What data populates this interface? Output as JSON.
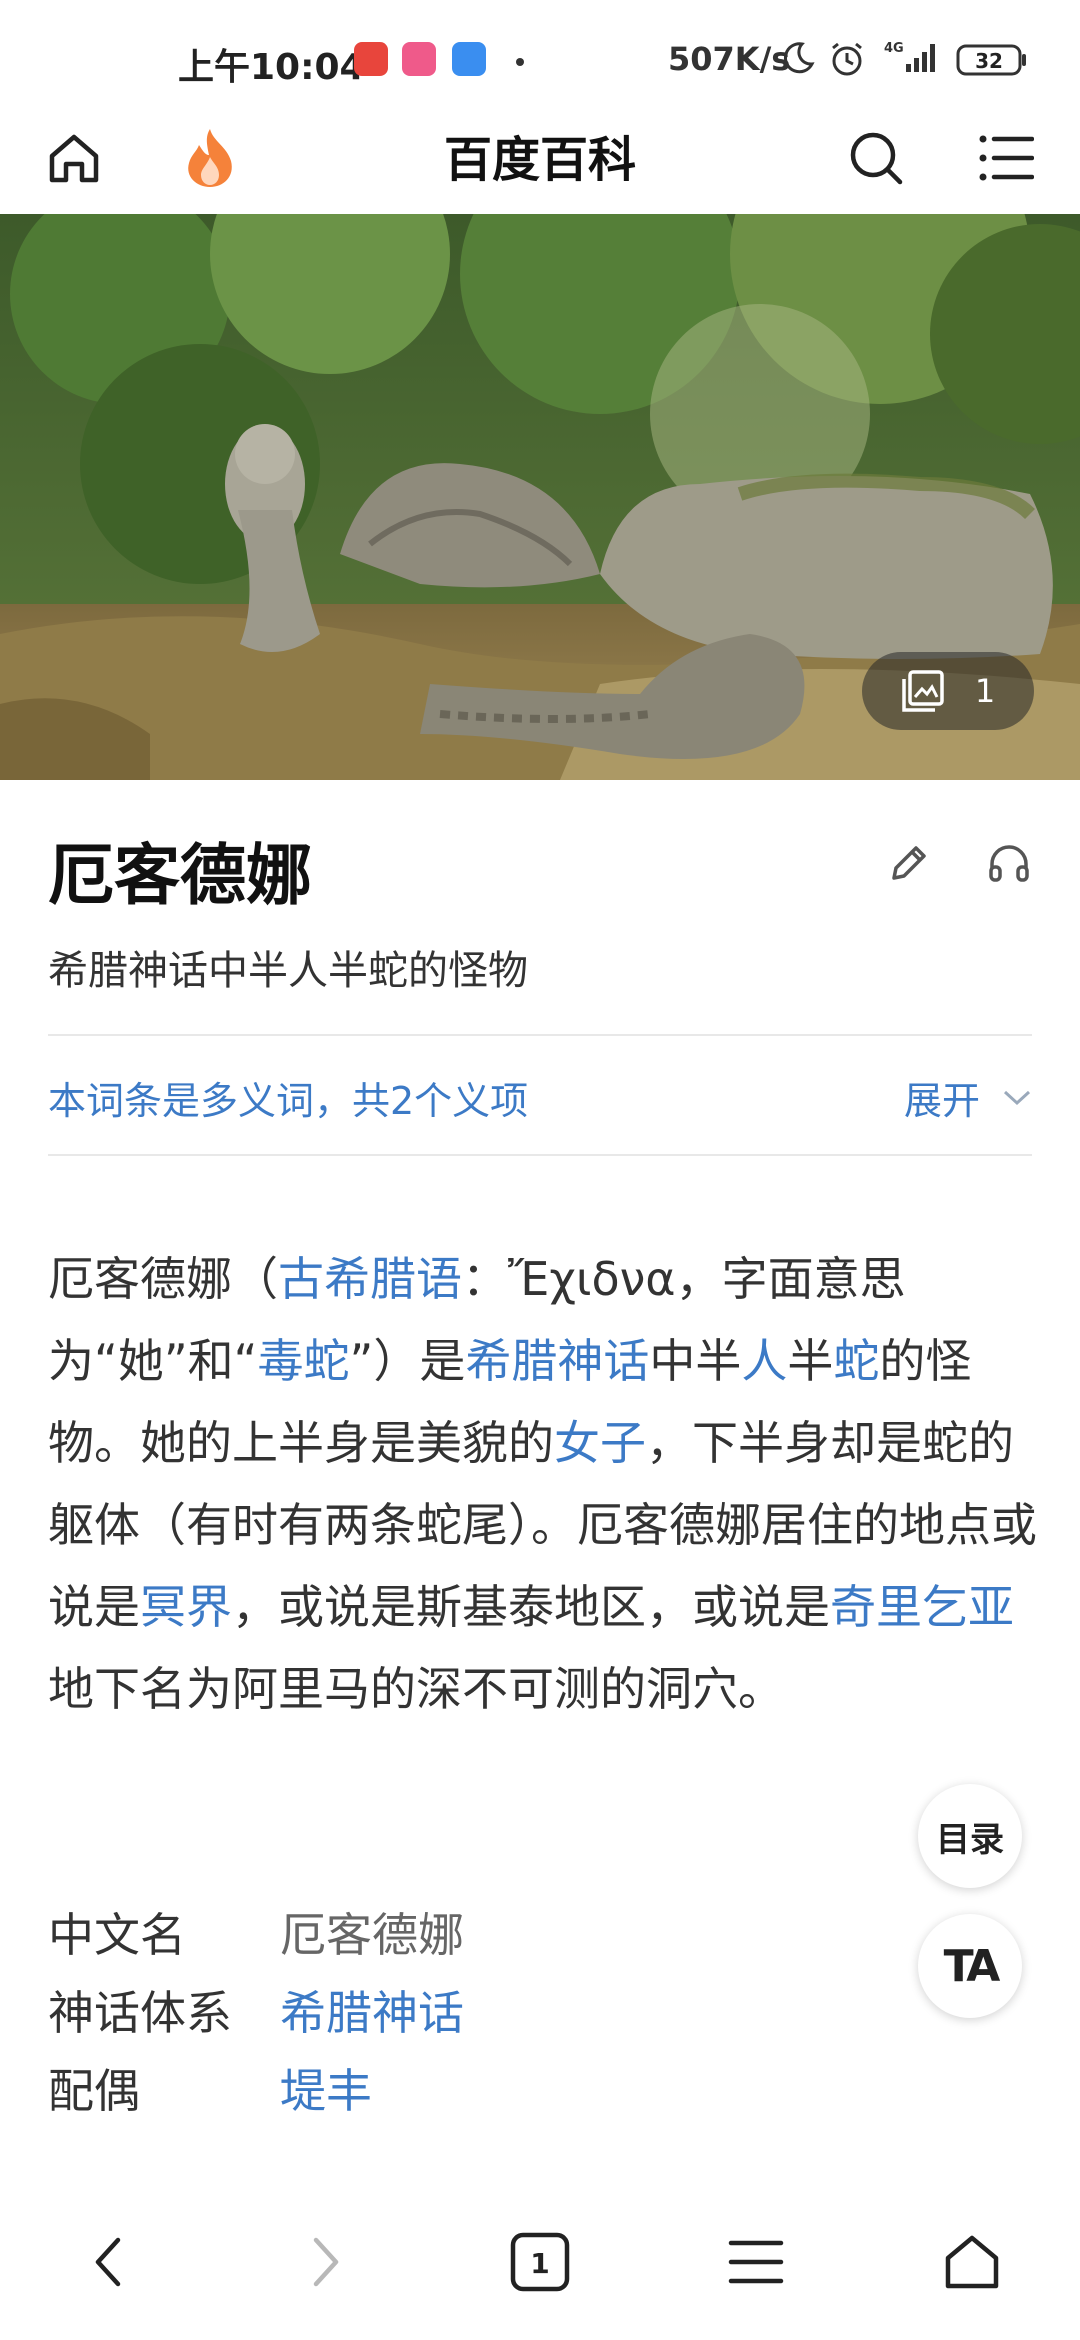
{
  "status_bar": {
    "time": "上午10:04",
    "net_speed": "507K/s",
    "network": "4G",
    "battery": "32"
  },
  "nav": {
    "title": "百度百科"
  },
  "hero": {
    "gallery_count": "1"
  },
  "entry": {
    "title": "厄客德娜",
    "subtitle": "希腊神话中半人半蛇的怪物",
    "polysemy_text": "本词条是多义词，共2个义项",
    "polysemy_toggle": "展开"
  },
  "summary": {
    "segments": [
      {
        "t": "厄客德娜（",
        "link": false
      },
      {
        "t": "古希腊语",
        "link": true
      },
      {
        "t": "：Ἔχιδνα，字面意思为“她”和“",
        "link": false
      },
      {
        "t": "毒蛇",
        "link": true
      },
      {
        "t": "”）是",
        "link": false
      },
      {
        "t": "希腊神话",
        "link": true
      },
      {
        "t": "中半",
        "link": false
      },
      {
        "t": "人",
        "link": true
      },
      {
        "t": "半",
        "link": false
      },
      {
        "t": "蛇",
        "link": true
      },
      {
        "t": "的怪物。她的上半身是美貌的",
        "link": false
      },
      {
        "t": "女子",
        "link": true
      },
      {
        "t": "，下半身却是蛇的躯体（有时有两条蛇尾）。厄客德娜居住的地点或说是",
        "link": false
      },
      {
        "t": "冥界",
        "link": true
      },
      {
        "t": "，或说是斯基泰地区，或说是",
        "link": false
      },
      {
        "t": "奇里乞亚",
        "link": true
      },
      {
        "t": "地下名为阿里马的深不可测的洞穴。",
        "link": false
      }
    ]
  },
  "info": {
    "rows": [
      {
        "key": "中文名",
        "value": "厄客德娜",
        "link": false
      },
      {
        "key": "神话体系",
        "value": "希腊神话",
        "link": true
      },
      {
        "key": "配偶",
        "value": "堤丰",
        "link": true
      }
    ]
  },
  "fabs": {
    "toc": "目录",
    "text_size": "TA"
  },
  "bottom_bar": {
    "tab_count": "1"
  },
  "colors": {
    "link": "#3c7ac6",
    "accent_flame": "#f5823a"
  }
}
